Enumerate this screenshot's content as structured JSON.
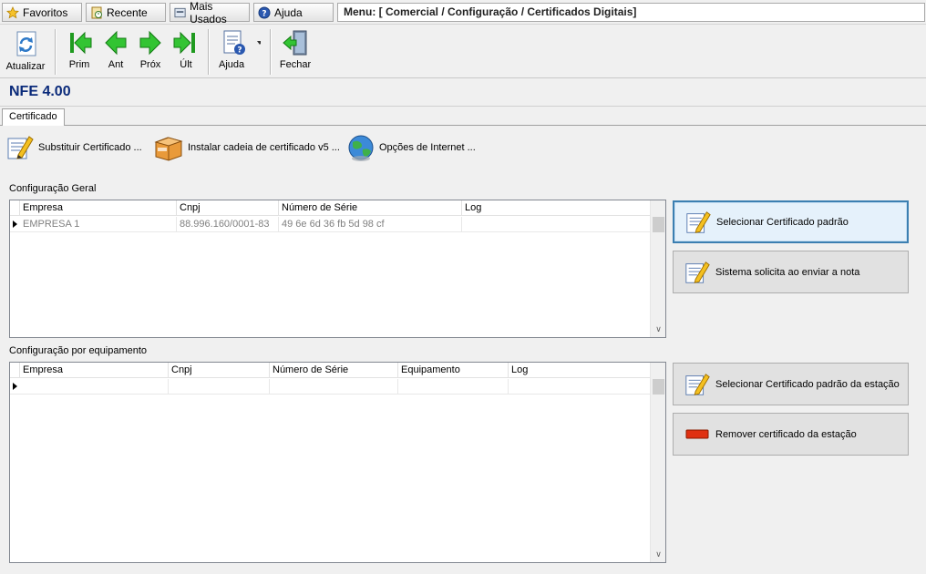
{
  "quickbar": {
    "favoritos": "Favoritos",
    "recente": "Recente",
    "mais_usados": "Mais Usados",
    "ajuda": "Ajuda",
    "menu_path": "Menu: [ Comercial / Configuração / Certificados Digitais]"
  },
  "toolbar": {
    "atualizar": "Atualizar",
    "prim": "Prim",
    "ant": "Ant",
    "prox": "Próx",
    "ult": "Últ",
    "ajuda": "Ajuda",
    "fechar": "Fechar"
  },
  "page_title": "NFE 4.00",
  "tabs": [
    {
      "label": "Certificado"
    }
  ],
  "actions": {
    "substituir": "Substituir Certificado ...",
    "instalar": "Instalar cadeia de certificado v5 ...",
    "opcoes": "Opções de Internet ..."
  },
  "config_geral": {
    "label": "Configuração Geral",
    "columns": [
      "Empresa",
      "Cnpj",
      "Número de Série",
      "Log"
    ],
    "rows": [
      {
        "empresa": "EMPRESA 1",
        "cnpj": "88.996.160/0001-83",
        "serie": "49 6e 6d 36 fb 5d 98 cf",
        "log": ""
      }
    ]
  },
  "config_equip": {
    "label": "Configuração por equipamento",
    "columns": [
      "Empresa",
      "Cnpj",
      "Número de Série",
      "Equipamento",
      "Log"
    ]
  },
  "buttons": {
    "selecionar_padrao": "Selecionar Certificado padrão",
    "sistema_solicita": "Sistema solicita ao enviar a nota",
    "selecionar_estacao": "Selecionar Certificado padrão da estação",
    "remover_estacao": "Remover certificado da estação"
  },
  "colors": {
    "title": "#0a2a7a",
    "nav_green": "#22b022",
    "remove_red": "#e03010"
  }
}
